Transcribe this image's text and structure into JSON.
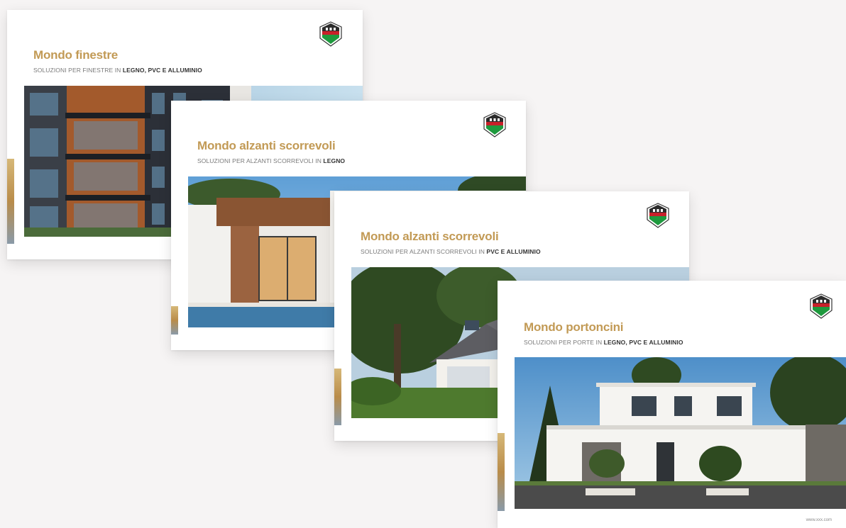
{
  "colors": {
    "accent": "#c29a55",
    "logo_green": "#1e9a3e",
    "logo_red": "#c8202a",
    "background": "#f6f4f4"
  },
  "cards": [
    {
      "title": "Mondo finestre",
      "subtitle_prefix": "SOLUZIONI PER FINESTRE IN ",
      "subtitle_bold": "LEGNO, PVC E ALLUMINIO",
      "logo_icon": "house-shield-logo-icon",
      "photo": "apartment-building-with-balconies"
    },
    {
      "title": "Mondo alzanti scorrevoli",
      "subtitle_prefix": "SOLUZIONI PER ALZANTI SCORREVOLI IN ",
      "subtitle_bold": "LEGNO",
      "logo_icon": "house-shield-logo-icon",
      "photo": "modern-villa-with-pool"
    },
    {
      "title": "Mondo alzanti scorrevoli",
      "subtitle_prefix": "SOLUZIONI PER ALZANTI SCORREVOLI IN ",
      "subtitle_bold": "PVC E ALLUMINIO",
      "logo_icon": "house-shield-logo-icon",
      "photo": "house-in-garden-with-trees"
    },
    {
      "title": "Mondo portoncini",
      "subtitle_prefix": "SOLUZIONI PER PORTE IN ",
      "subtitle_bold": "LEGNO, PVC E ALLUMINIO",
      "logo_icon": "house-shield-logo-icon",
      "photo": "modern-white-house-facade",
      "footer": "www.xxx.com"
    }
  ]
}
